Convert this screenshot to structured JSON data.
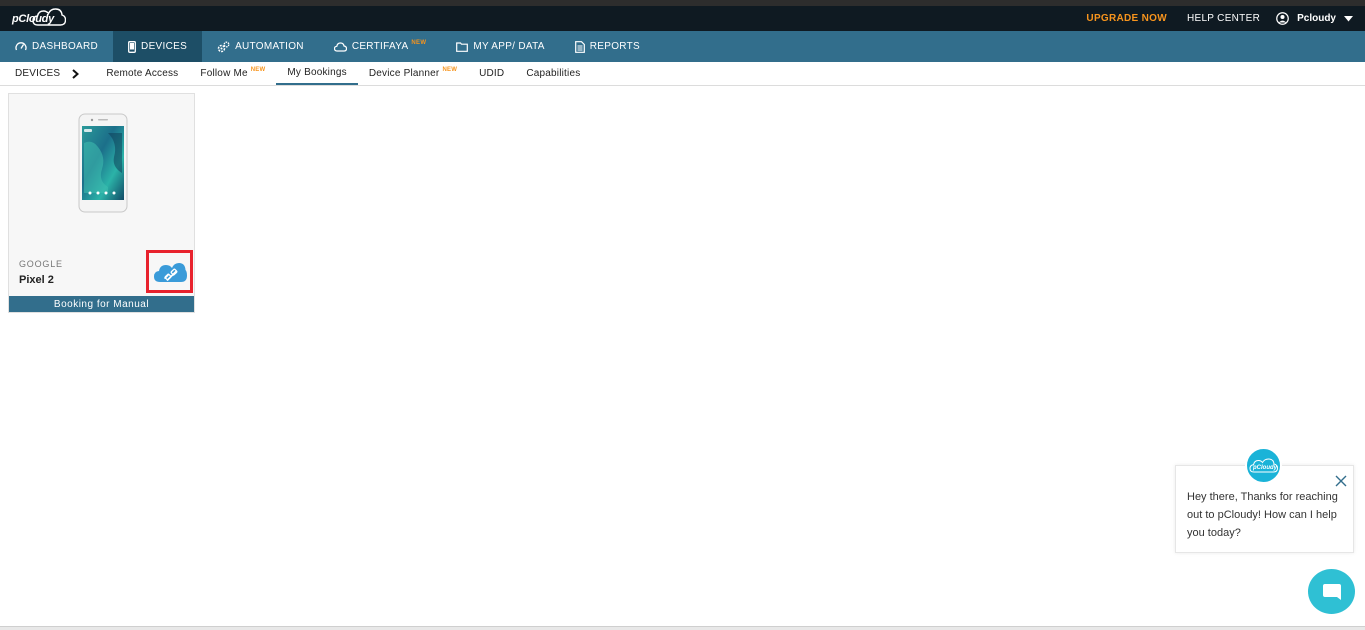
{
  "header": {
    "logo_text": "pCloudy",
    "upgrade_label": "UPGRADE NOW",
    "help_label": "HELP CENTER",
    "user_name": "Pcloudy"
  },
  "nav": {
    "items": [
      {
        "label": "DASHBOARD",
        "icon": "gauge-icon",
        "new": ""
      },
      {
        "label": "DEVICES",
        "icon": "mobile-icon",
        "new": ""
      },
      {
        "label": "AUTOMATION",
        "icon": "gears-icon",
        "new": ""
      },
      {
        "label": "CERTIFAYA",
        "icon": "cloud-icon",
        "new": "NEW"
      },
      {
        "label": "MY APP/ DATA",
        "icon": "folder-icon",
        "new": ""
      },
      {
        "label": "REPORTS",
        "icon": "document-icon",
        "new": ""
      }
    ],
    "active": "DEVICES"
  },
  "subnav": {
    "section": "DEVICES",
    "items": [
      {
        "label": "Remote Access",
        "new": ""
      },
      {
        "label": "Follow Me",
        "new": "NEW"
      },
      {
        "label": "My Bookings",
        "new": ""
      },
      {
        "label": "Device Planner",
        "new": "NEW"
      },
      {
        "label": "UDID",
        "new": ""
      },
      {
        "label": "Capabilities",
        "new": ""
      }
    ],
    "active": "My Bookings"
  },
  "device_card": {
    "brand": "GOOGLE",
    "model": "Pixel 2",
    "booking_label": "Booking for Manual"
  },
  "chat": {
    "message": "Hey there, Thanks for reaching out to pCloudy! How can I help you today?",
    "avatar_text": "pCloudy"
  },
  "colors": {
    "accent": "#326e8c",
    "active_nav": "#1d4e66",
    "upgrade": "#f7941d",
    "highlight_box": "#e8222d",
    "chat": "#2fc0d4"
  }
}
